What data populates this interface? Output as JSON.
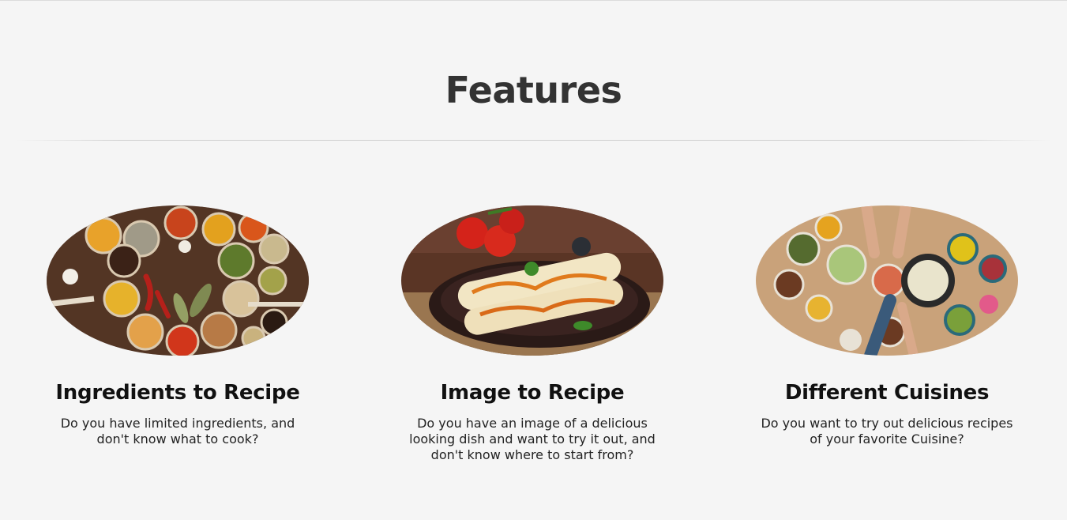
{
  "section": {
    "title": "Features"
  },
  "features": [
    {
      "image_name": "spices-image",
      "title": "Ingredients to Recipe",
      "description": "Do you have limited ingredients, and don't know what to cook?"
    },
    {
      "image_name": "enchilada-dish-image",
      "title": "Image to Recipe",
      "description": "Do you have an image of a delicious looking dish and want to try it out, and don't know where to start from?"
    },
    {
      "image_name": "cuisines-table-image",
      "title": "Different Cuisines",
      "description": "Do you want to try out delicious recipes of your favorite Cuisine?"
    }
  ],
  "colors": {
    "background": "#f5f5f5",
    "title_text": "#333333",
    "body_text": "#222222"
  }
}
